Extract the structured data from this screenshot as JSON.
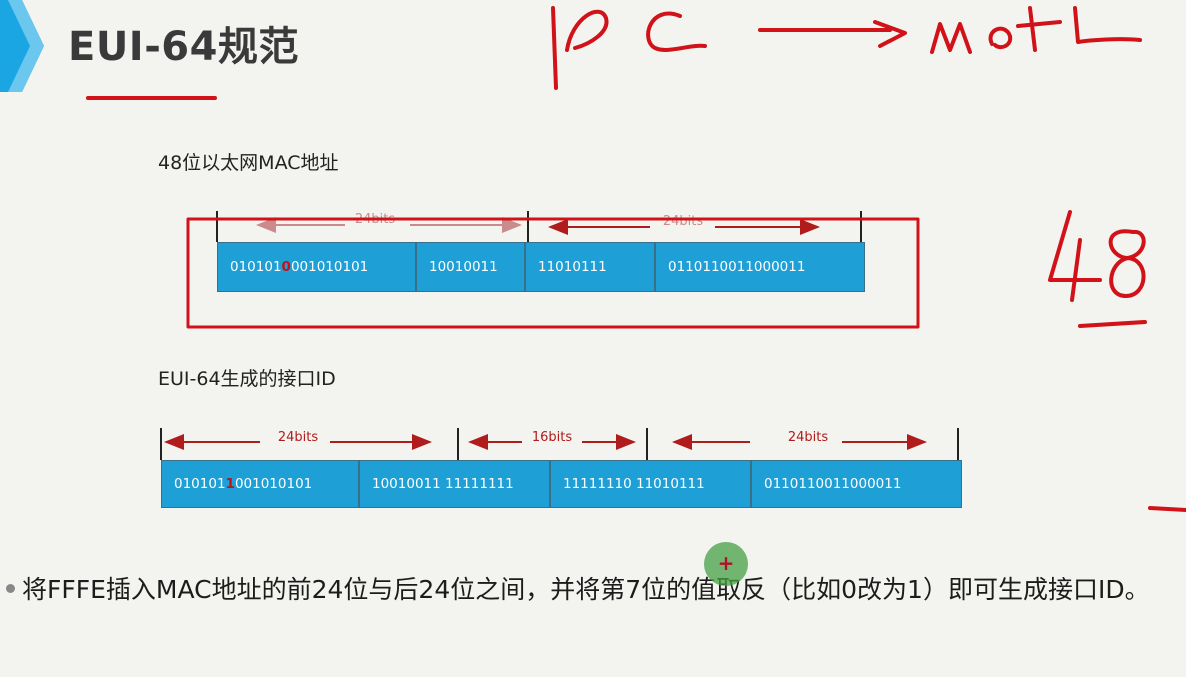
{
  "slide": {
    "title": "EUI-64规范",
    "label_mac": "48位以太网MAC地址",
    "label_eui": "EUI-64生成的接口ID",
    "bullet": "将FFFE插入MAC地址的前24位与后24位之间，并将第7位的值取反（比如0改为1）即可生成接口ID。"
  },
  "mac_bar": {
    "segments": [
      {
        "pre": "010101",
        "bit": "0",
        "post": "001010101"
      },
      {
        "text": "10010011"
      },
      {
        "text": "11010111"
      },
      {
        "text": "0110110011000011"
      }
    ],
    "dims": [
      {
        "label": "24bits"
      },
      {
        "label": "24bits"
      }
    ]
  },
  "eui_bar": {
    "segments": [
      {
        "pre": "010101",
        "bit": "1",
        "post": "001010101"
      },
      {
        "text": "10010011 11111111"
      },
      {
        "text": "11111110 11010111"
      },
      {
        "text": "0110110011000011"
      }
    ],
    "dims": [
      {
        "label": "24bits"
      },
      {
        "label": "16bits"
      },
      {
        "label": "24bits"
      }
    ]
  },
  "colors": {
    "bar_fill": "#1e9fd6",
    "annotation_red": "#c0121a",
    "chevron_blue": "#1aa5e3"
  },
  "icons": [
    "chevron-icon",
    "cursor-marker-icon"
  ]
}
